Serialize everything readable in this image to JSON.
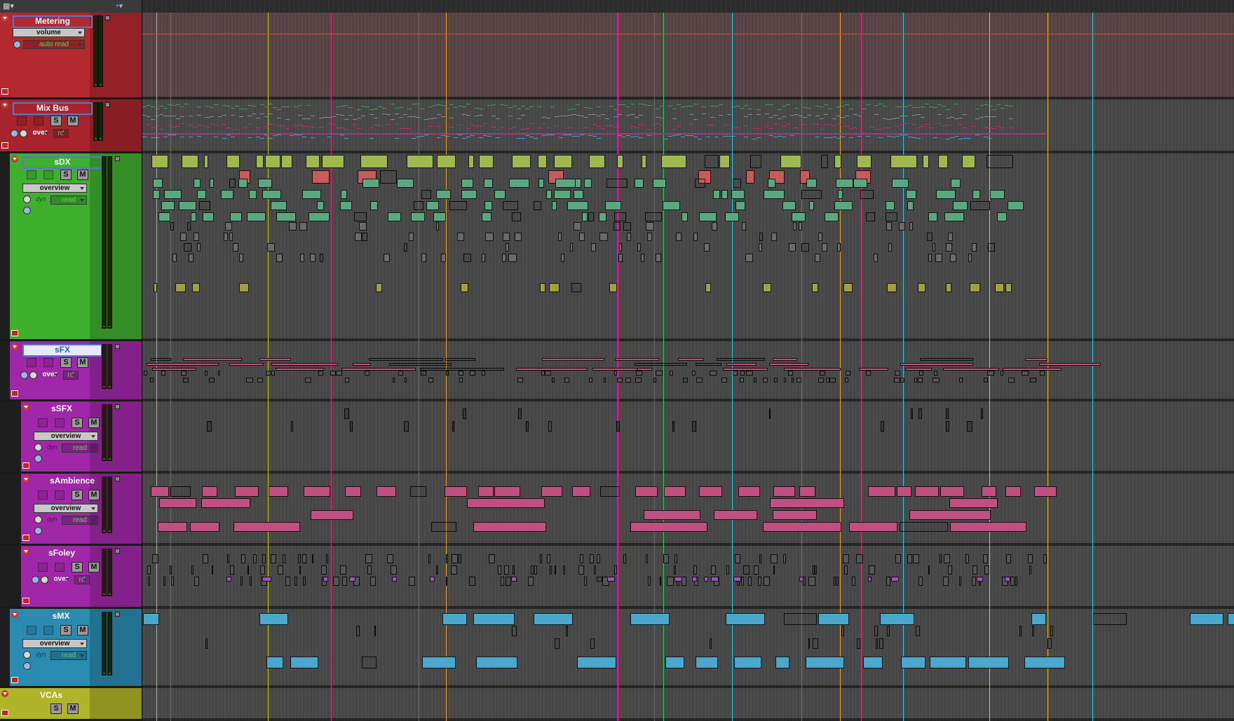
{
  "toolbar": {
    "left_icon": "grid-menu-icon",
    "right_icon": "sync-clock-icon"
  },
  "tracks": [
    {
      "id": "metering",
      "name": "Metering",
      "color": "#b42830",
      "view": "volume",
      "automation": "auto read",
      "buttons": false
    },
    {
      "id": "mixbus",
      "name": "Mix Bus",
      "color": "#a8242c",
      "view": "",
      "automation": "rd",
      "mode": "over",
      "buttons": true
    },
    {
      "id": "sdx",
      "name": "sDX",
      "color": "#3faf2e",
      "view": "overview",
      "automation": "read",
      "dyn": "dyn",
      "buttons": true
    },
    {
      "id": "sfx",
      "name": "sFX",
      "color": "#a028a8",
      "view": "",
      "automation": "rd",
      "mode": "over",
      "buttons": true
    },
    {
      "id": "ssfx",
      "name": "sSFX",
      "color": "#a028a8",
      "view": "overview",
      "automation": "read",
      "dyn": "dyn",
      "buttons": true
    },
    {
      "id": "sambience",
      "name": "sAmbience",
      "color": "#a028a8",
      "view": "overview",
      "automation": "read",
      "dyn": "dyn",
      "buttons": true
    },
    {
      "id": "sfoley",
      "name": "sFoley",
      "color": "#a028a8",
      "view": "",
      "automation": "rd",
      "mode": "over",
      "buttons": true
    },
    {
      "id": "smx",
      "name": "sMX",
      "color": "#2a8ab0",
      "view": "overview",
      "automation": "read",
      "dyn": "dyn",
      "buttons": true
    },
    {
      "id": "vcas",
      "name": "VCAs",
      "color": "#b0b428",
      "view": "",
      "automation": "",
      "buttons": true
    }
  ],
  "button_labels": {
    "solo": "S",
    "mute": "M"
  },
  "icons": {
    "record": "record-icon",
    "star": "star-icon",
    "clock": "automation-clock-icon",
    "folder": "folder-icon"
  },
  "markers": [
    {
      "x_pct": 0.013,
      "color": "#e8a020"
    },
    {
      "x_pct": 0.026,
      "color": "#e02a80"
    },
    {
      "x_pct": 0.115,
      "color": "#c8c820"
    },
    {
      "x_pct": 0.173,
      "color": "#e02a80"
    },
    {
      "x_pct": 0.253,
      "color": "#a040e0"
    },
    {
      "x_pct": 0.278,
      "color": "#e8a020"
    },
    {
      "x_pct": 0.435,
      "color": "#a040e0"
    },
    {
      "x_pct": 0.436,
      "color": "#e02a40"
    },
    {
      "x_pct": 0.469,
      "color": "#e02a40"
    },
    {
      "x_pct": 0.477,
      "color": "#30d060"
    },
    {
      "x_pct": 0.54,
      "color": "#30c8e0"
    },
    {
      "x_pct": 0.604,
      "color": "#a040e0"
    },
    {
      "x_pct": 0.639,
      "color": "#e8a020"
    },
    {
      "x_pct": 0.658,
      "color": "#e02a80"
    },
    {
      "x_pct": 0.697,
      "color": "#30c8e0"
    },
    {
      "x_pct": 0.776,
      "color": "#e8c020"
    },
    {
      "x_pct": 0.829,
      "color": "#e8c020"
    },
    {
      "x_pct": 0.87,
      "color": "#30c8e0"
    }
  ]
}
